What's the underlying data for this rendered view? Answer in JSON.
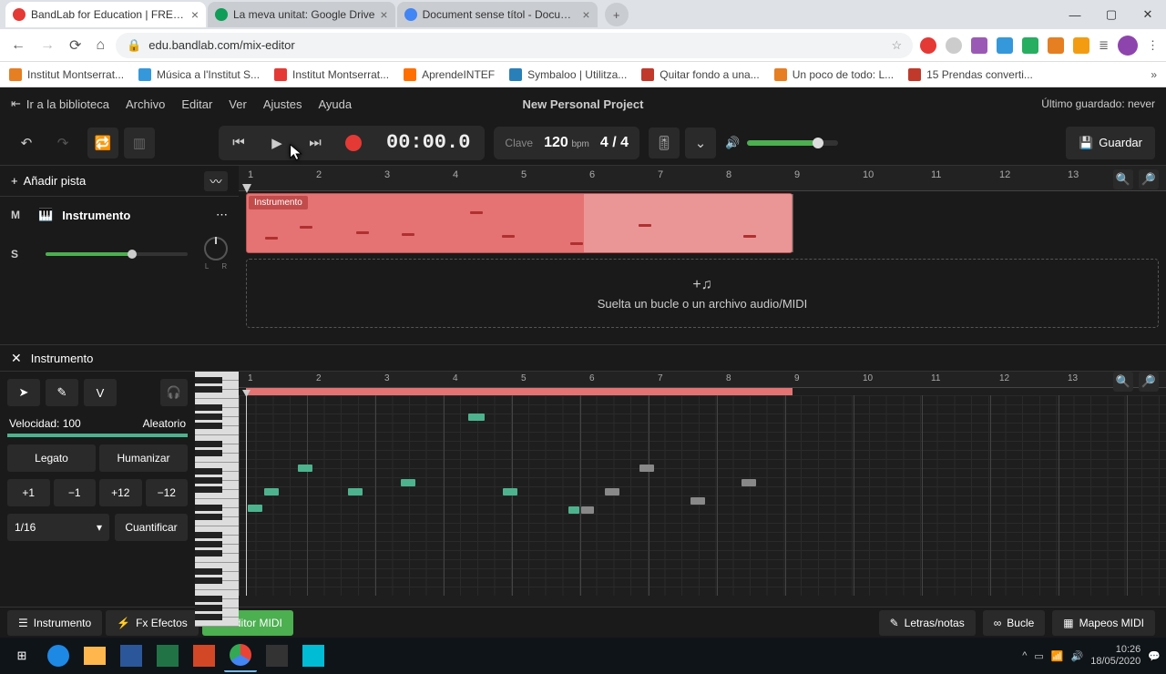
{
  "browser": {
    "tabs": [
      {
        "title": "BandLab for Education | FREE A...",
        "favicon": "#e53935"
      },
      {
        "title": "La meva unitat: Google Drive",
        "favicon": "#0f9d58"
      },
      {
        "title": "Document sense títol - Docume...",
        "favicon": "#4285f4"
      }
    ],
    "url": "edu.bandlab.com/mix-editor",
    "bookmarks": [
      {
        "label": "Institut Montserrat...",
        "color": "#e67e22"
      },
      {
        "label": "Música a l'Institut S...",
        "color": "#3498db"
      },
      {
        "label": "Institut Montserrat...",
        "color": "#e53935"
      },
      {
        "label": "AprendeINTEF",
        "color": "#ff6f00"
      },
      {
        "label": "Symbaloo | Utilitza...",
        "color": "#2980b9"
      },
      {
        "label": "Quitar fondo a una...",
        "color": "#c0392b"
      },
      {
        "label": "Un poco de todo: L...",
        "color": "#e67e22"
      },
      {
        "label": "15 Prendas converti...",
        "color": "#c0392b"
      }
    ]
  },
  "app": {
    "library": "Ir a la biblioteca",
    "menus": [
      "Archivo",
      "Editar",
      "Ver",
      "Ajustes",
      "Ayuda"
    ],
    "project_title": "New Personal Project",
    "last_saved_label": "Último guardado: never"
  },
  "toolbar": {
    "timecode": "00:00.0",
    "key_label": "Clave",
    "tempo": "120",
    "tempo_unit": "bpm",
    "time_sig": "4 / 4",
    "save_label": "Guardar"
  },
  "tracks": {
    "add_label": "Añadir pista",
    "track_name": "Instrumento",
    "clip_label": "Instrumento",
    "m": "M",
    "s": "S",
    "drop_hint": "Suelta un bucle o un archivo audio/MIDI"
  },
  "ruler_numbers": [
    "1",
    "2",
    "3",
    "4",
    "5",
    "6",
    "7",
    "8",
    "9",
    "10",
    "11",
    "12",
    "13"
  ],
  "editor": {
    "title": "Instrumento",
    "velocity_label": "Velocidad: 100",
    "random_label": "Aleatorio",
    "legato": "Legato",
    "humanize": "Humanizar",
    "transpose": [
      "+1",
      "−1",
      "+12",
      "−12"
    ],
    "quantize_val": "1/16",
    "quantize_btn": "Cuantificar",
    "v_btn": "V"
  },
  "bottom_tabs": {
    "instrument": "Instrumento",
    "fx": "Fx Efectos",
    "midi_editor": "Editor MIDI",
    "lyrics": "Letras/notas",
    "loop": "Bucle",
    "mappings": "Mapeos MIDI"
  },
  "taskbar": {
    "time": "10:26",
    "date": "18/05/2020"
  }
}
